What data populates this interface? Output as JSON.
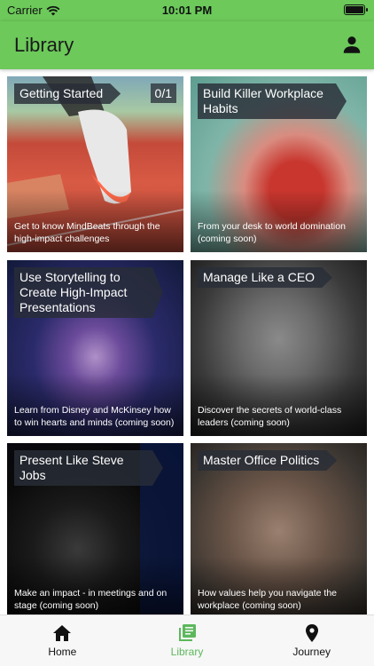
{
  "status": {
    "carrier": "Carrier",
    "time": "10:01 PM"
  },
  "nav": {
    "title": "Library",
    "profile_icon": "person-icon"
  },
  "cards": [
    {
      "title": "Getting Started",
      "count": "0/1",
      "description": "Get to know MindBeats through the high-impact challenges"
    },
    {
      "title": "Build Killer Workplace Habits",
      "description": "From your desk to world domination (coming soon)"
    },
    {
      "title": "Use Storytelling to Create High-Impact Presentations",
      "description": "Learn from Disney and McKinsey how to win hearts and minds (coming soon)"
    },
    {
      "title": "Manage Like a CEO",
      "description": "Discover the secrets of world-class leaders (coming soon)"
    },
    {
      "title": "Present Like Steve Jobs",
      "description": "Make an impact - in meetings and on stage (coming soon)"
    },
    {
      "title": "Master Office Politics",
      "description": "How values help you navigate the workplace (coming soon)"
    }
  ],
  "tabs": [
    {
      "label": "Home",
      "icon": "home-icon"
    },
    {
      "label": "Library",
      "icon": "library-icon",
      "active": true
    },
    {
      "label": "Journey",
      "icon": "location-pin-icon"
    }
  ],
  "colors": {
    "accent": "#6cc95a",
    "active_tab": "#5cb85c"
  }
}
